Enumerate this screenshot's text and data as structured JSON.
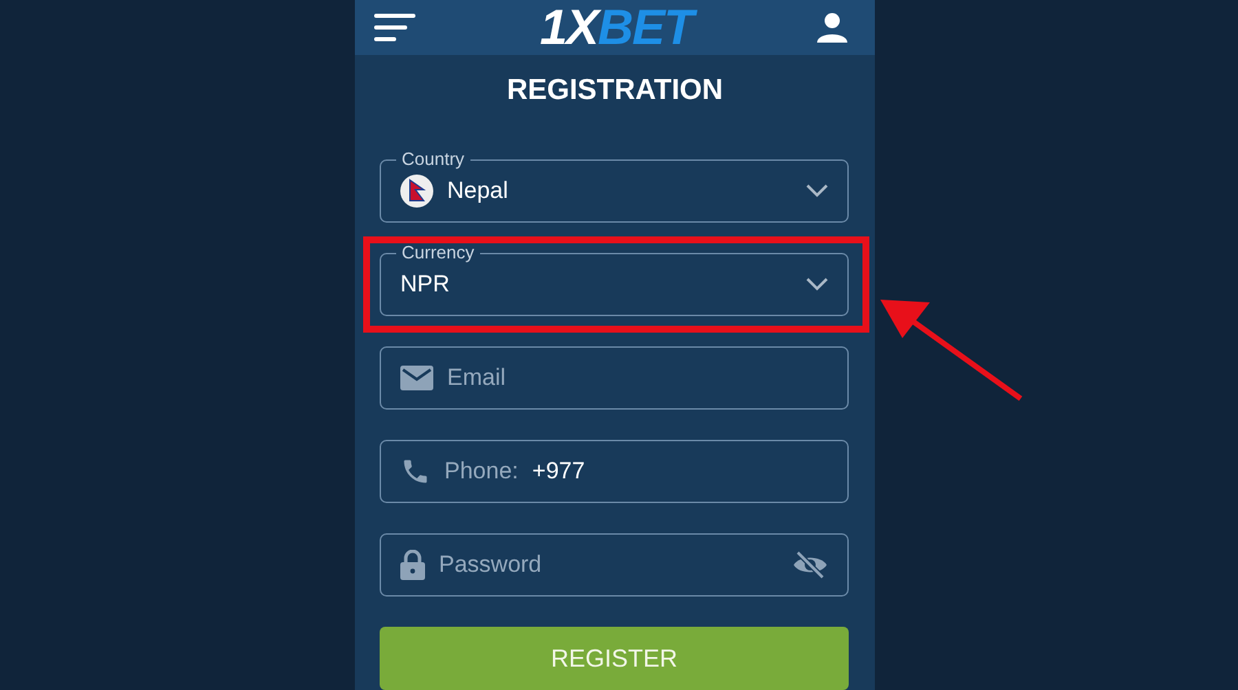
{
  "header": {
    "logo": {
      "prefix": "1X",
      "suffix": "BET"
    }
  },
  "title": "REGISTRATION",
  "fields": [
    {
      "kind": "country",
      "label": "Country",
      "value": "Nepal",
      "highlighted": false
    },
    {
      "kind": "select",
      "label": "Currency",
      "value": "NPR",
      "highlighted": true
    },
    {
      "kind": "email",
      "placeholder": "Email",
      "highlighted": false
    },
    {
      "kind": "phone",
      "placeholder": "Phone:",
      "value": "+977",
      "highlighted": false
    },
    {
      "kind": "password",
      "placeholder": "Password",
      "highlighted": false
    }
  ],
  "submit": {
    "label": "REGISTER"
  }
}
